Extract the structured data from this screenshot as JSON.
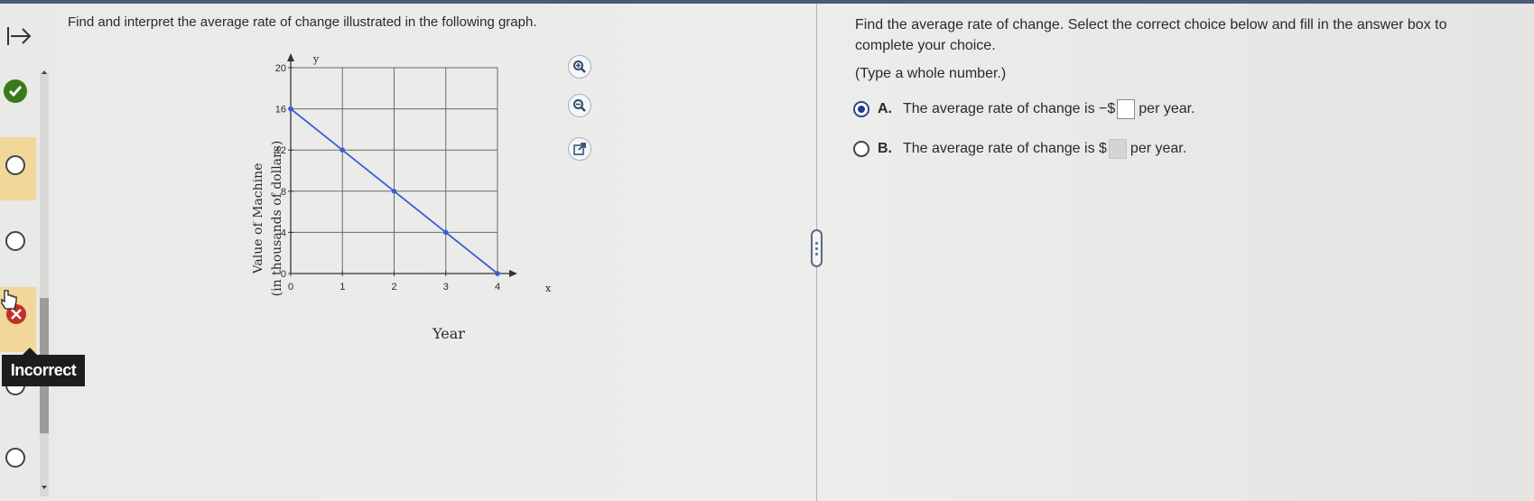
{
  "left": {
    "question": "Find and interpret the average rate of change illustrated in the following graph.",
    "tooltip": "Incorrect"
  },
  "chart_data": {
    "type": "line",
    "xlabel": "Year",
    "ylabel_line1": "Value of Machine",
    "ylabel_line2": "(in thousands of dollars)",
    "x_axis_name": "x",
    "y_axis_name": "y",
    "xlim": [
      0,
      4
    ],
    "ylim": [
      0,
      20
    ],
    "x_ticks": [
      0,
      1,
      2,
      3,
      4
    ],
    "y_ticks": [
      0,
      4,
      8,
      12,
      16,
      20
    ],
    "grid": true,
    "series": [
      {
        "x": [
          0,
          1,
          2,
          3,
          4
        ],
        "y": [
          16,
          12,
          8,
          4,
          0
        ],
        "color": "#3b5bd6"
      }
    ]
  },
  "right": {
    "instruction": "Find the average rate of change. Select the correct choice below and fill in the answer box to complete your choice.",
    "hint": "(Type a whole number.)",
    "choices": [
      {
        "letter": "A.",
        "before": "The average rate of change is −$",
        "after": "per year.",
        "selected": true
      },
      {
        "letter": "B.",
        "before": "The average rate of change is $",
        "after": "per year.",
        "selected": false
      }
    ]
  },
  "colors": {
    "accent": "#1f3f80",
    "line": "#3b5bd6",
    "tooltip_bg": "#1d1d1d",
    "correct_green": "#3a7a1c",
    "incorrect_red": "#c0302a",
    "tab_highlight": "#f1d79a"
  }
}
